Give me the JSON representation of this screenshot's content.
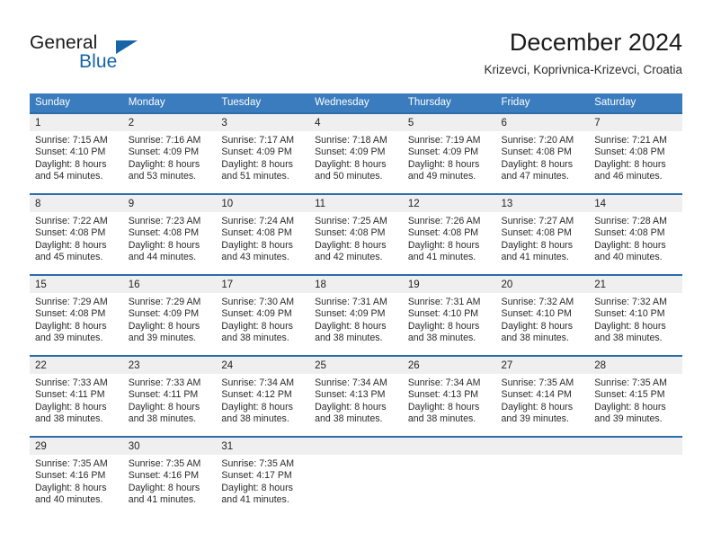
{
  "brand": {
    "name_part1": "General",
    "name_part2": "Blue",
    "accent_color": "#1565a8"
  },
  "header": {
    "title": "December 2024",
    "subtitle": "Krizevci, Koprivnica-Krizevci, Croatia"
  },
  "theme": {
    "header_row_bg": "#3a7cbe",
    "row_divider": "#2b6cab",
    "daynum_bg": "#efefef"
  },
  "weekday_headers": [
    "Sunday",
    "Monday",
    "Tuesday",
    "Wednesday",
    "Thursday",
    "Friday",
    "Saturday"
  ],
  "weeks": [
    [
      {
        "day": "1",
        "sunrise": "Sunrise: 7:15 AM",
        "sunset": "Sunset: 4:10 PM",
        "daylight_line1": "Daylight: 8 hours",
        "daylight_line2": "and 54 minutes."
      },
      {
        "day": "2",
        "sunrise": "Sunrise: 7:16 AM",
        "sunset": "Sunset: 4:09 PM",
        "daylight_line1": "Daylight: 8 hours",
        "daylight_line2": "and 53 minutes."
      },
      {
        "day": "3",
        "sunrise": "Sunrise: 7:17 AM",
        "sunset": "Sunset: 4:09 PM",
        "daylight_line1": "Daylight: 8 hours",
        "daylight_line2": "and 51 minutes."
      },
      {
        "day": "4",
        "sunrise": "Sunrise: 7:18 AM",
        "sunset": "Sunset: 4:09 PM",
        "daylight_line1": "Daylight: 8 hours",
        "daylight_line2": "and 50 minutes."
      },
      {
        "day": "5",
        "sunrise": "Sunrise: 7:19 AM",
        "sunset": "Sunset: 4:09 PM",
        "daylight_line1": "Daylight: 8 hours",
        "daylight_line2": "and 49 minutes."
      },
      {
        "day": "6",
        "sunrise": "Sunrise: 7:20 AM",
        "sunset": "Sunset: 4:08 PM",
        "daylight_line1": "Daylight: 8 hours",
        "daylight_line2": "and 47 minutes."
      },
      {
        "day": "7",
        "sunrise": "Sunrise: 7:21 AM",
        "sunset": "Sunset: 4:08 PM",
        "daylight_line1": "Daylight: 8 hours",
        "daylight_line2": "and 46 minutes."
      }
    ],
    [
      {
        "day": "8",
        "sunrise": "Sunrise: 7:22 AM",
        "sunset": "Sunset: 4:08 PM",
        "daylight_line1": "Daylight: 8 hours",
        "daylight_line2": "and 45 minutes."
      },
      {
        "day": "9",
        "sunrise": "Sunrise: 7:23 AM",
        "sunset": "Sunset: 4:08 PM",
        "daylight_line1": "Daylight: 8 hours",
        "daylight_line2": "and 44 minutes."
      },
      {
        "day": "10",
        "sunrise": "Sunrise: 7:24 AM",
        "sunset": "Sunset: 4:08 PM",
        "daylight_line1": "Daylight: 8 hours",
        "daylight_line2": "and 43 minutes."
      },
      {
        "day": "11",
        "sunrise": "Sunrise: 7:25 AM",
        "sunset": "Sunset: 4:08 PM",
        "daylight_line1": "Daylight: 8 hours",
        "daylight_line2": "and 42 minutes."
      },
      {
        "day": "12",
        "sunrise": "Sunrise: 7:26 AM",
        "sunset": "Sunset: 4:08 PM",
        "daylight_line1": "Daylight: 8 hours",
        "daylight_line2": "and 41 minutes."
      },
      {
        "day": "13",
        "sunrise": "Sunrise: 7:27 AM",
        "sunset": "Sunset: 4:08 PM",
        "daylight_line1": "Daylight: 8 hours",
        "daylight_line2": "and 41 minutes."
      },
      {
        "day": "14",
        "sunrise": "Sunrise: 7:28 AM",
        "sunset": "Sunset: 4:08 PM",
        "daylight_line1": "Daylight: 8 hours",
        "daylight_line2": "and 40 minutes."
      }
    ],
    [
      {
        "day": "15",
        "sunrise": "Sunrise: 7:29 AM",
        "sunset": "Sunset: 4:08 PM",
        "daylight_line1": "Daylight: 8 hours",
        "daylight_line2": "and 39 minutes."
      },
      {
        "day": "16",
        "sunrise": "Sunrise: 7:29 AM",
        "sunset": "Sunset: 4:09 PM",
        "daylight_line1": "Daylight: 8 hours",
        "daylight_line2": "and 39 minutes."
      },
      {
        "day": "17",
        "sunrise": "Sunrise: 7:30 AM",
        "sunset": "Sunset: 4:09 PM",
        "daylight_line1": "Daylight: 8 hours",
        "daylight_line2": "and 38 minutes."
      },
      {
        "day": "18",
        "sunrise": "Sunrise: 7:31 AM",
        "sunset": "Sunset: 4:09 PM",
        "daylight_line1": "Daylight: 8 hours",
        "daylight_line2": "and 38 minutes."
      },
      {
        "day": "19",
        "sunrise": "Sunrise: 7:31 AM",
        "sunset": "Sunset: 4:10 PM",
        "daylight_line1": "Daylight: 8 hours",
        "daylight_line2": "and 38 minutes."
      },
      {
        "day": "20",
        "sunrise": "Sunrise: 7:32 AM",
        "sunset": "Sunset: 4:10 PM",
        "daylight_line1": "Daylight: 8 hours",
        "daylight_line2": "and 38 minutes."
      },
      {
        "day": "21",
        "sunrise": "Sunrise: 7:32 AM",
        "sunset": "Sunset: 4:10 PM",
        "daylight_line1": "Daylight: 8 hours",
        "daylight_line2": "and 38 minutes."
      }
    ],
    [
      {
        "day": "22",
        "sunrise": "Sunrise: 7:33 AM",
        "sunset": "Sunset: 4:11 PM",
        "daylight_line1": "Daylight: 8 hours",
        "daylight_line2": "and 38 minutes."
      },
      {
        "day": "23",
        "sunrise": "Sunrise: 7:33 AM",
        "sunset": "Sunset: 4:11 PM",
        "daylight_line1": "Daylight: 8 hours",
        "daylight_line2": "and 38 minutes."
      },
      {
        "day": "24",
        "sunrise": "Sunrise: 7:34 AM",
        "sunset": "Sunset: 4:12 PM",
        "daylight_line1": "Daylight: 8 hours",
        "daylight_line2": "and 38 minutes."
      },
      {
        "day": "25",
        "sunrise": "Sunrise: 7:34 AM",
        "sunset": "Sunset: 4:13 PM",
        "daylight_line1": "Daylight: 8 hours",
        "daylight_line2": "and 38 minutes."
      },
      {
        "day": "26",
        "sunrise": "Sunrise: 7:34 AM",
        "sunset": "Sunset: 4:13 PM",
        "daylight_line1": "Daylight: 8 hours",
        "daylight_line2": "and 38 minutes."
      },
      {
        "day": "27",
        "sunrise": "Sunrise: 7:35 AM",
        "sunset": "Sunset: 4:14 PM",
        "daylight_line1": "Daylight: 8 hours",
        "daylight_line2": "and 39 minutes."
      },
      {
        "day": "28",
        "sunrise": "Sunrise: 7:35 AM",
        "sunset": "Sunset: 4:15 PM",
        "daylight_line1": "Daylight: 8 hours",
        "daylight_line2": "and 39 minutes."
      }
    ],
    [
      {
        "day": "29",
        "sunrise": "Sunrise: 7:35 AM",
        "sunset": "Sunset: 4:16 PM",
        "daylight_line1": "Daylight: 8 hours",
        "daylight_line2": "and 40 minutes."
      },
      {
        "day": "30",
        "sunrise": "Sunrise: 7:35 AM",
        "sunset": "Sunset: 4:16 PM",
        "daylight_line1": "Daylight: 8 hours",
        "daylight_line2": "and 41 minutes."
      },
      {
        "day": "31",
        "sunrise": "Sunrise: 7:35 AM",
        "sunset": "Sunset: 4:17 PM",
        "daylight_line1": "Daylight: 8 hours",
        "daylight_line2": "and 41 minutes."
      },
      {
        "day": "",
        "sunrise": "",
        "sunset": "",
        "daylight_line1": "",
        "daylight_line2": ""
      },
      {
        "day": "",
        "sunrise": "",
        "sunset": "",
        "daylight_line1": "",
        "daylight_line2": ""
      },
      {
        "day": "",
        "sunrise": "",
        "sunset": "",
        "daylight_line1": "",
        "daylight_line2": ""
      },
      {
        "day": "",
        "sunrise": "",
        "sunset": "",
        "daylight_line1": "",
        "daylight_line2": ""
      }
    ]
  ]
}
